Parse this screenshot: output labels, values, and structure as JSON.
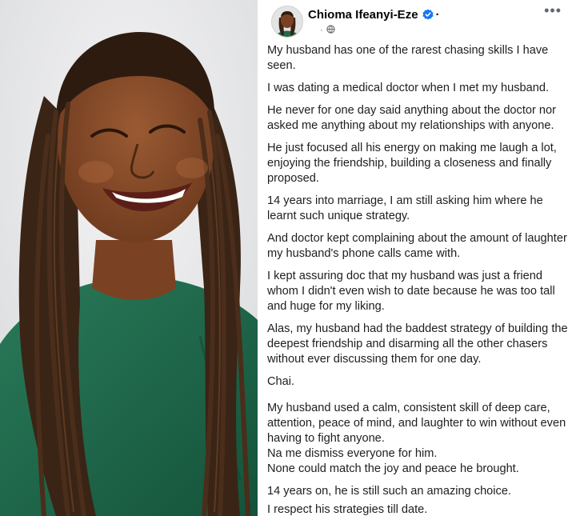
{
  "post": {
    "author_name": "Chioma Ifeanyi-Eze",
    "more_label": "•••",
    "meta_separator": "·",
    "paragraphs": [
      "My husband has one of the rarest chasing skills I have seen.",
      "I was dating a medical doctor when I met my husband.",
      "He never for one day said anything about the doctor nor asked me anything about my relationships with anyone.",
      "He just focused all his energy on making me laugh a lot, enjoying the friendship, building a closeness and finally proposed.",
      "14 years into marriage, I am still asking him where he learnt such unique strategy.",
      "And doctor kept complaining about the amount of laughter my husband's phone calls came with.",
      "I kept assuring doc that my husband was just a friend whom I didn't even wish to date because he was too tall and huge for my liking.",
      "Alas, my husband had the baddest strategy of building the deepest friendship and disarming all the other chasers without ever discussing them for one day.",
      "Chai."
    ],
    "closing_block": [
      "My husband used a calm, consistent skill of deep care, attention, peace of mind, and laughter to win without even having to fight anyone.",
      "Na me dismiss everyone for him.",
      "None could match the joy and peace he brought."
    ],
    "final_lines": [
      "14 years on, he is still such an amazing choice.",
      "I respect his strategies till date."
    ]
  },
  "icons": {
    "verified": "verified-badge-icon",
    "privacy": "globe-icon",
    "more": "more-options-icon"
  },
  "colors": {
    "verified_blue": "#1877f2",
    "text": "#1c1e21",
    "meta_gray": "#65676b",
    "shirt_green": "#1f6b4e"
  }
}
